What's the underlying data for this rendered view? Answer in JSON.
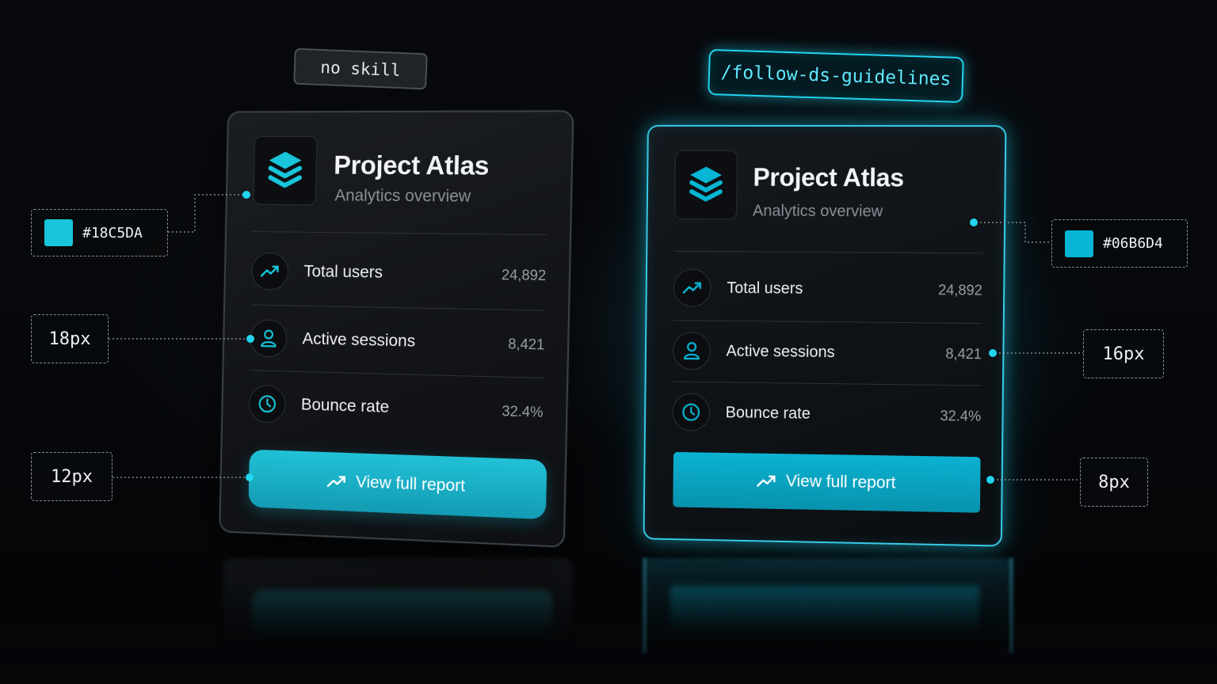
{
  "labels": {
    "left": "no skill",
    "right": "/follow-ds-guidelines"
  },
  "cards": {
    "left": {
      "title": "Project Atlas",
      "subtitle": "Analytics overview",
      "rows": [
        {
          "icon": "trending-up-icon",
          "label": "Total users",
          "value": "24,892"
        },
        {
          "icon": "user-icon",
          "label": "Active sessions",
          "value": "8,421"
        },
        {
          "icon": "clock-icon",
          "label": "Bounce rate",
          "value": "32.4%"
        }
      ],
      "cta": "View full report"
    },
    "right": {
      "title": "Project Atlas",
      "subtitle": "Analytics overview",
      "rows": [
        {
          "icon": "trending-up-icon",
          "label": "Total users",
          "value": "24,892"
        },
        {
          "icon": "user-icon",
          "label": "Active sessions",
          "value": "8,421"
        },
        {
          "icon": "clock-icon",
          "label": "Bounce rate",
          "value": "32.4%"
        }
      ],
      "cta": "View full report"
    }
  },
  "annotations": {
    "left": {
      "color": "#18C5DA",
      "spacing": "18px",
      "radius": "12px"
    },
    "right": {
      "color": "#06B6D4",
      "spacing": "16px",
      "radius": "8px"
    }
  },
  "colors": {
    "left_accent": "#18C5DA",
    "right_accent": "#06B6D4",
    "background": "#05070a"
  }
}
